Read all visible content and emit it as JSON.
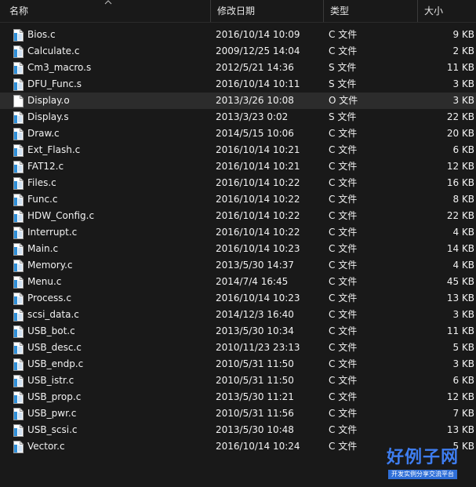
{
  "columns": {
    "name": "名称",
    "date": "修改日期",
    "type": "类型",
    "size": "大小"
  },
  "colors": {
    "background": "#191919",
    "selected_row": "#2c2c2c",
    "text": "#f2f2f2"
  },
  "files": [
    {
      "name": "Bios.c",
      "date": "2016/10/14 10:09",
      "type": "C 文件",
      "size": "9 KB",
      "icon": "c-file-icon"
    },
    {
      "name": "Calculate.c",
      "date": "2009/12/25 14:04",
      "type": "C 文件",
      "size": "2 KB",
      "icon": "c-file-icon"
    },
    {
      "name": "Cm3_macro.s",
      "date": "2012/5/21 14:36",
      "type": "S 文件",
      "size": "11 KB",
      "icon": "s-file-icon"
    },
    {
      "name": "DFU_Func.s",
      "date": "2016/10/14 10:11",
      "type": "S 文件",
      "size": "3 KB",
      "icon": "s-file-icon"
    },
    {
      "name": "Display.o",
      "date": "2013/3/26 10:08",
      "type": "O 文件",
      "size": "3 KB",
      "icon": "o-file-icon",
      "selected": true
    },
    {
      "name": "Display.s",
      "date": "2013/3/23 0:02",
      "type": "S 文件",
      "size": "22 KB",
      "icon": "s-file-icon"
    },
    {
      "name": "Draw.c",
      "date": "2014/5/15 10:06",
      "type": "C 文件",
      "size": "20 KB",
      "icon": "c-file-icon"
    },
    {
      "name": "Ext_Flash.c",
      "date": "2016/10/14 10:21",
      "type": "C 文件",
      "size": "6 KB",
      "icon": "c-file-icon"
    },
    {
      "name": "FAT12.c",
      "date": "2016/10/14 10:21",
      "type": "C 文件",
      "size": "12 KB",
      "icon": "c-file-icon"
    },
    {
      "name": "Files.c",
      "date": "2016/10/14 10:22",
      "type": "C 文件",
      "size": "16 KB",
      "icon": "c-file-icon"
    },
    {
      "name": "Func.c",
      "date": "2016/10/14 10:22",
      "type": "C 文件",
      "size": "8 KB",
      "icon": "c-file-icon"
    },
    {
      "name": "HDW_Config.c",
      "date": "2016/10/14 10:22",
      "type": "C 文件",
      "size": "22 KB",
      "icon": "c-file-icon"
    },
    {
      "name": "Interrupt.c",
      "date": "2016/10/14 10:22",
      "type": "C 文件",
      "size": "4 KB",
      "icon": "c-file-icon"
    },
    {
      "name": "Main.c",
      "date": "2016/10/14 10:23",
      "type": "C 文件",
      "size": "14 KB",
      "icon": "c-file-icon"
    },
    {
      "name": "Memory.c",
      "date": "2013/5/30 14:37",
      "type": "C 文件",
      "size": "4 KB",
      "icon": "c-file-icon"
    },
    {
      "name": "Menu.c",
      "date": "2014/7/4 16:45",
      "type": "C 文件",
      "size": "45 KB",
      "icon": "c-file-icon"
    },
    {
      "name": "Process.c",
      "date": "2016/10/14 10:23",
      "type": "C 文件",
      "size": "13 KB",
      "icon": "c-file-icon"
    },
    {
      "name": "scsi_data.c",
      "date": "2014/12/3 16:40",
      "type": "C 文件",
      "size": "3 KB",
      "icon": "c-file-icon"
    },
    {
      "name": "USB_bot.c",
      "date": "2013/5/30 10:34",
      "type": "C 文件",
      "size": "11 KB",
      "icon": "c-file-icon"
    },
    {
      "name": "USB_desc.c",
      "date": "2010/11/23 23:13",
      "type": "C 文件",
      "size": "5 KB",
      "icon": "c-file-icon"
    },
    {
      "name": "USB_endp.c",
      "date": "2010/5/31 11:50",
      "type": "C 文件",
      "size": "3 KB",
      "icon": "c-file-icon"
    },
    {
      "name": "USB_istr.c",
      "date": "2010/5/31 11:50",
      "type": "C 文件",
      "size": "6 KB",
      "icon": "c-file-icon"
    },
    {
      "name": "USB_prop.c",
      "date": "2013/5/30 11:21",
      "type": "C 文件",
      "size": "12 KB",
      "icon": "c-file-icon"
    },
    {
      "name": "USB_pwr.c",
      "date": "2010/5/31 11:56",
      "type": "C 文件",
      "size": "7 KB",
      "icon": "c-file-icon"
    },
    {
      "name": "USB_scsi.c",
      "date": "2013/5/30 10:48",
      "type": "C 文件",
      "size": "13 KB",
      "icon": "c-file-icon"
    },
    {
      "name": "Vector.c",
      "date": "2016/10/14 10:24",
      "type": "C 文件",
      "size": "5 KB",
      "icon": "c-file-icon"
    }
  ],
  "watermark": {
    "title": "好例子网",
    "subtitle": "开发实例分享交流平台"
  }
}
